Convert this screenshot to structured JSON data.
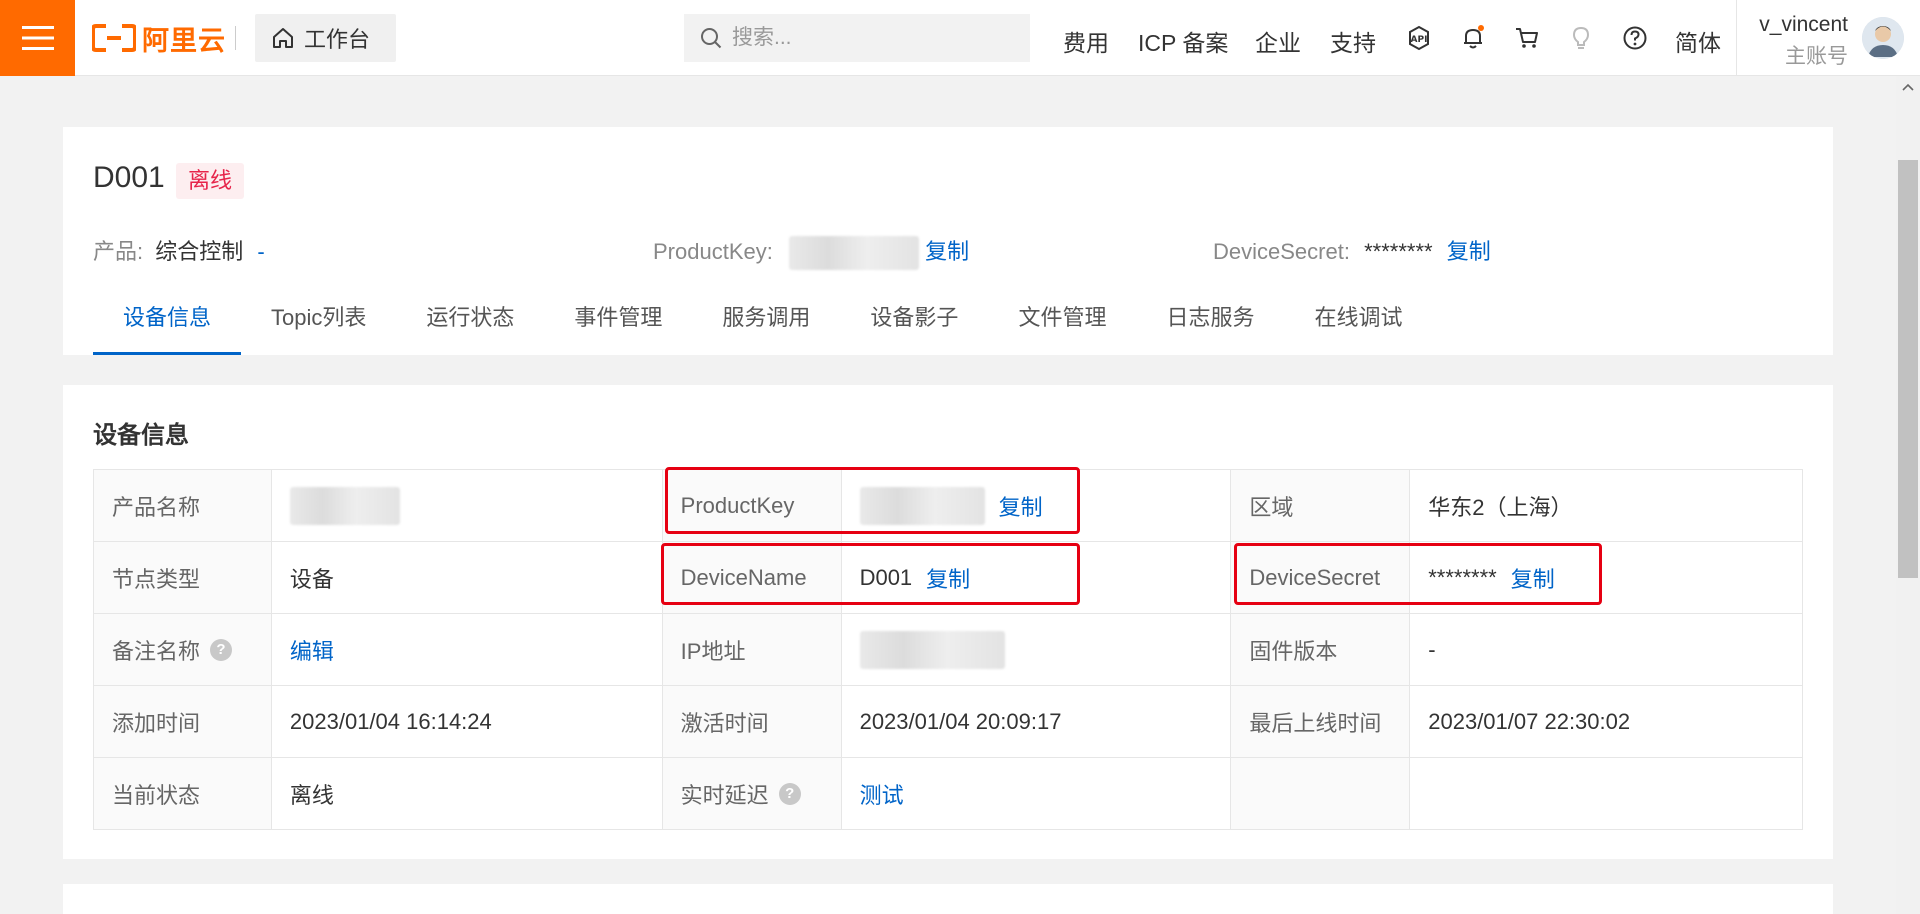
{
  "topbar": {
    "logo_text": "阿里云",
    "workbench_label": "工作台",
    "search_placeholder": "搜索...",
    "nav": [
      "费用",
      "ICP 备案",
      "企业",
      "支持"
    ],
    "lang": "简体",
    "user_name": "v_vincent",
    "user_role": "主账号",
    "accent": "#ff6a00"
  },
  "header": {
    "device_name": "D001",
    "status": "离线",
    "product_label": "产品:",
    "product_value": "综合控制",
    "product_link": "-",
    "productkey_label": "ProductKey:",
    "productkey_copy": "复制",
    "devicesecret_label": "DeviceSecret:",
    "devicesecret_value": "********",
    "devicesecret_copy": "复制",
    "tabs": [
      "设备信息",
      "Topic列表",
      "运行状态",
      "事件管理",
      "服务调用",
      "设备影子",
      "文件管理",
      "日志服务",
      "在线调试"
    ]
  },
  "info": {
    "title": "设备信息",
    "rows": [
      {
        "l1": "产品名称",
        "l2": "ProductKey",
        "v2_link": "复制",
        "l3": "区域",
        "v3": "华东2（上海）"
      },
      {
        "l1": "节点类型",
        "v1": "设备",
        "l2": "DeviceName",
        "v2": "D001",
        "v2_link": "复制",
        "l3": "DeviceSecret",
        "v3": "********",
        "v3_link": "复制"
      },
      {
        "l1": "备注名称",
        "v1_link": "编辑",
        "l2": "IP地址",
        "l3": "固件版本",
        "v3": "-"
      },
      {
        "l1": "添加时间",
        "v1": "2023/01/04 16:14:24",
        "l2": "激活时间",
        "v2": "2023/01/04 20:09:17",
        "l3": "最后上线时间",
        "v3": "2023/01/07 22:30:02"
      },
      {
        "l1": "当前状态",
        "v1": "离线",
        "l2": "实时延迟",
        "v2_link": "测试"
      }
    ],
    "help_glyph": "?"
  },
  "colors": {
    "link": "#0064c8",
    "highlight": "#e60012",
    "offline_tag_bg": "#fdeef0",
    "offline_tag_text": "#e6244a"
  }
}
